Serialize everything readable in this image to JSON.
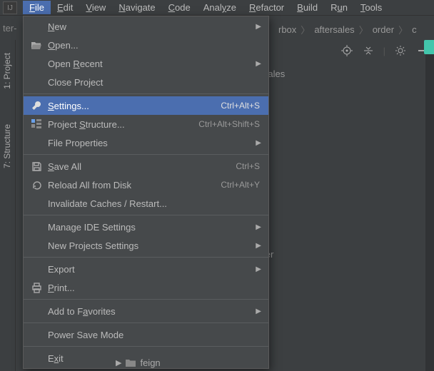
{
  "menubar": {
    "items": [
      {
        "label": "File",
        "mn": "F",
        "rest": "ile",
        "active": true
      },
      {
        "label": "Edit",
        "mn": "E",
        "rest": "dit"
      },
      {
        "label": "View",
        "mn": "V",
        "rest": "iew"
      },
      {
        "label": "Navigate",
        "mn": "N",
        "rest": "avigate"
      },
      {
        "label": "Code",
        "mn": "C",
        "rest": "ode"
      },
      {
        "label": "Analyze",
        "mn": "",
        "rest": "Analyze",
        "mnpos": 4,
        "pre": "Anal",
        "post": "ze"
      },
      {
        "label": "Refactor",
        "mn": "R",
        "rest": "efactor"
      },
      {
        "label": "Build",
        "mn": "B",
        "rest": "uild"
      },
      {
        "label": "Run",
        "mn": "",
        "pre": "R",
        "mnc": "u",
        "post": "n"
      },
      {
        "label": "Tools",
        "mn": "T",
        "rest": "ools"
      }
    ]
  },
  "left_strip": "ter-",
  "breadcrumb": [
    "rbox",
    "aftersales",
    "order",
    "c"
  ],
  "sidebar": {
    "tabs": [
      "1: Project",
      "7: Structure"
    ]
  },
  "bg_visible": [
    "er-sales",
    "order"
  ],
  "file_menu": {
    "items": [
      {
        "label": "New",
        "mn": "N",
        "rest": "ew",
        "submenu": true
      },
      {
        "label": "Open...",
        "mn": "O",
        "rest": "pen...",
        "icon": "folder-open"
      },
      {
        "label": "Open Recent",
        "pre": "Open ",
        "mn": "R",
        "rest": "ecent",
        "submenu": true
      },
      {
        "label": "Close Project",
        "plain": "Close Project"
      },
      {
        "sep": true
      },
      {
        "label": "Settings...",
        "mn": "S",
        "rest": "ettings...",
        "icon": "wrench",
        "shortcut": "Ctrl+Alt+S",
        "highlight": true
      },
      {
        "label": "Project Structure...",
        "pre": "Project ",
        "mn": "S",
        "rest": "tructure...",
        "icon": "structure",
        "shortcut": "Ctrl+Alt+Shift+S"
      },
      {
        "label": "File Properties",
        "plain": "File Properties",
        "submenu": true
      },
      {
        "sep": true
      },
      {
        "label": "Save All",
        "mn": "S",
        "rest": "ave All",
        "icon": "save",
        "shortcut": "Ctrl+S"
      },
      {
        "label": "Reload All from Disk",
        "plain": "Reload All from Disk",
        "icon": "reload",
        "shortcut": "Ctrl+Alt+Y"
      },
      {
        "label": "Invalidate Caches / Restart...",
        "plain": "Invalidate Caches / Restart..."
      },
      {
        "sep": true
      },
      {
        "label": "Manage IDE Settings",
        "plain": "Manage IDE Settings",
        "submenu": true
      },
      {
        "label": "New Projects Settings",
        "plain": "New Projects Settings",
        "submenu": true
      },
      {
        "sep": true
      },
      {
        "label": "Export",
        "plain": "Export",
        "submenu": true
      },
      {
        "label": "Print...",
        "mn": "P",
        "rest": "rint...",
        "icon": "print"
      },
      {
        "sep": true
      },
      {
        "label": "Add to Favorites",
        "pre": "Add to F",
        "mn": "a",
        "rest": "vorites",
        "submenu": true
      },
      {
        "sep": true
      },
      {
        "label": "Power Save Mode",
        "plain": "Power Save Mode"
      },
      {
        "sep": true
      },
      {
        "label": "Exit",
        "pre": "E",
        "mn": "x",
        "rest": "it"
      }
    ]
  },
  "bottom": {
    "folder": "feign"
  }
}
